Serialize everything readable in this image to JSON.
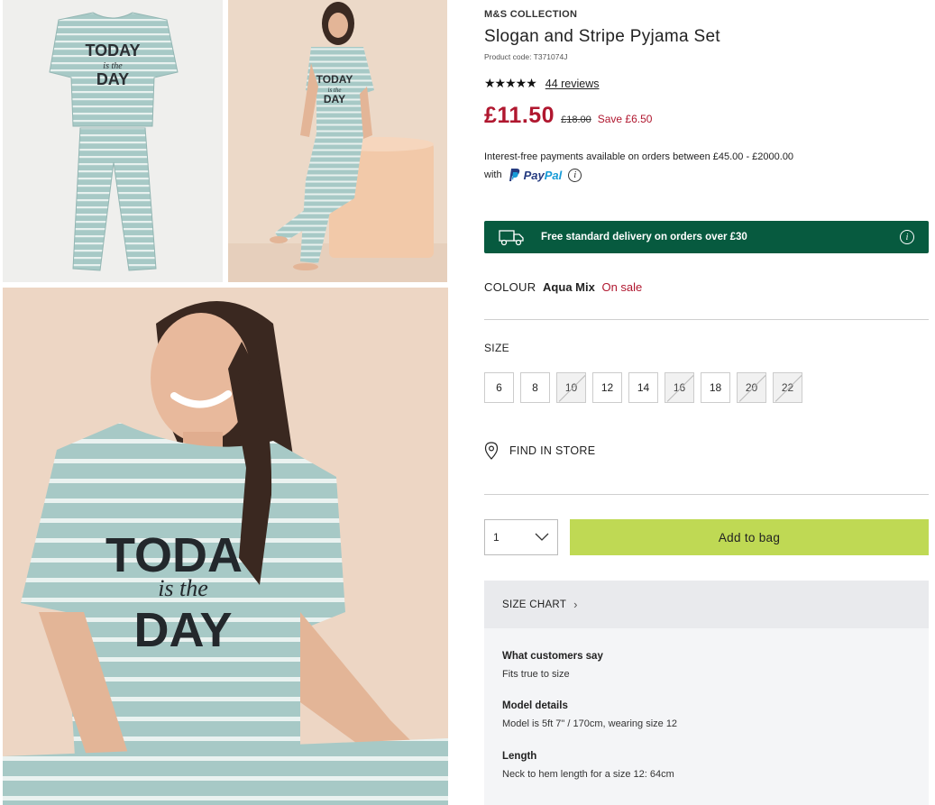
{
  "product": {
    "brand": "M&S COLLECTION",
    "title": "Slogan and Stripe Pyjama Set",
    "code": "Product code: T371074J",
    "stars": "★★★★★",
    "rating_out_of_5": 5,
    "reviews": "44 reviews",
    "price": "£11.50",
    "was_price": "£18.00",
    "save": "Save £6.50"
  },
  "paypal": {
    "line1": "Interest-free payments available on orders between £45.00 - £2000.00",
    "with": "with",
    "logo_p1": "Pay",
    "logo_p2": "Pal",
    "info_glyph": "i"
  },
  "delivery": {
    "text": "Free standard delivery on orders over £30",
    "info_glyph": "i"
  },
  "colour": {
    "label": "COLOUR",
    "value": "Aqua Mix",
    "status": "On sale"
  },
  "size": {
    "label": "SIZE",
    "options": [
      {
        "label": "6"
      },
      {
        "label": "8"
      },
      {
        "label": "10"
      },
      {
        "label": "12"
      },
      {
        "label": "14"
      },
      {
        "label": "16"
      },
      {
        "label": "18"
      },
      {
        "label": "20"
      },
      {
        "label": "22"
      }
    ]
  },
  "store": {
    "label": "FIND IN STORE"
  },
  "purchase": {
    "quantity": "1",
    "add_to_bag": "Add to bag"
  },
  "size_chart": {
    "label": "SIZE CHART",
    "arrow": "›"
  },
  "details": {
    "customers_h": "What customers say",
    "customers_v": "Fits true to size",
    "model_h": "Model details",
    "model_v": "Model is 5ft 7\" / 170cm, wearing size 12",
    "length_h": "Length",
    "length_v": "Neck to hem length for a size 12: 64cm"
  },
  "images": {
    "slogan_line1": "TODAY",
    "slogan_line2": "is the",
    "slogan_line3": "DAY",
    "close_slogan_line1": "TODA",
    "close_slogan_line2": "is the",
    "close_slogan_line3": "DAY"
  },
  "colors": {
    "price_red": "#b0172f",
    "delivery_green": "#075a3f",
    "add_to_bag_green": "#bfd954",
    "pyjama_aqua": "#a7c9c6"
  }
}
